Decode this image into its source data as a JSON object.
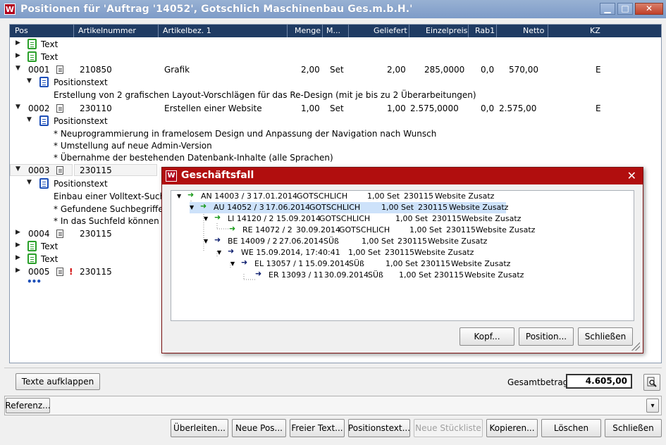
{
  "window": {
    "title": "Positionen für 'Auftrag '14052', Gotschlich Maschinenbau Ges.m.b.H.'",
    "app_icon": "W"
  },
  "grid": {
    "headers": [
      "Pos",
      "Artikelnummer",
      "Artikelbez. 1",
      "Menge",
      "M...",
      "Geliefert",
      "Einzelpreis",
      "Rab1",
      "Netto",
      "KZ"
    ],
    "rows": {
      "r0": {
        "text": "Text"
      },
      "r1": {
        "text": "Text"
      },
      "r2": {
        "pos": "0001",
        "artnr": "210850",
        "bez": "Grafik",
        "menge": "2,00",
        "me": "Set",
        "geliefert": "2,00",
        "ep": "285,0000",
        "rab": "0,0",
        "netto": "570,00",
        "kz": "E"
      },
      "r3": {
        "text": "Positionstext"
      },
      "r4": {
        "text": "Erstellung von 2 grafischen Layout-Vorschlägen für das Re-Design (mit je bis zu 2 Überarbeitungen)"
      },
      "r5": {
        "pos": "0002",
        "artnr": "230110",
        "bez": "Erstellen einer Website",
        "menge": "1,00",
        "me": "Set",
        "geliefert": "1,00",
        "ep": "2.575,0000",
        "rab": "0,0",
        "netto": "2.575,00",
        "kz": "E"
      },
      "r6": {
        "text": "Positionstext"
      },
      "r7": {
        "text": "* Neuprogrammierung in framelosem Design und Anpassung der Navigation nach Wunsch"
      },
      "r8": {
        "text": "* Umstellung auf neue Admin-Version"
      },
      "r9": {
        "text": "* Übernahme der bestehenden Datenbank-Inhalte (alle Sprachen)"
      },
      "r10": {
        "pos": "0003",
        "artnr": "230115"
      },
      "r11": {
        "text": "Positionstext"
      },
      "r12": {
        "text": "Einbau einer Volltext-Such"
      },
      "r13": {
        "text": "* Gefundene Suchbegriffe"
      },
      "r14": {
        "text": "* In das Suchfeld können n"
      },
      "r15": {
        "pos": "0004",
        "artnr": "230115"
      },
      "r16": {
        "text": "Text"
      },
      "r17": {
        "text": "Text"
      },
      "r18": {
        "pos": "0005",
        "artnr": "230115",
        "flag": "!"
      },
      "r19": {
        "text": "•••"
      }
    }
  },
  "footer": {
    "expand_label": "Texte aufklappen",
    "total_label": "Gesamtbetrag:",
    "total_value": "4.605,00",
    "reference_label": "Referenz..."
  },
  "buttons": {
    "ueberleiten": "Überleiten...",
    "neue_pos": "Neue Pos...",
    "freier_text": "Freier Text...",
    "positionstext": "Positionstext...",
    "neue_stueckliste": "Neue Stückliste",
    "kopieren": "Kopieren...",
    "loeschen": "Löschen",
    "schliessen": "Schließen"
  },
  "dialog": {
    "title": "Geschäftsfall",
    "close_glyph": "✕",
    "nodes": [
      {
        "doc": "AN 14003 / 3",
        "date": "17.01.2014",
        "who": "GOTSCHLICH",
        "qty": "1,00 Set",
        "art": "230115",
        "desc": "Website Zusatz"
      },
      {
        "doc": "AU 14052 / 3",
        "date": "17.06.2014",
        "who": "GOTSCHLICH",
        "qty": "1,00 Set",
        "art": "230115",
        "desc": "Website Zusatz"
      },
      {
        "doc": "LI 14120 / 2",
        "date": "15.09.2014",
        "who": "GOTSCHLICH",
        "qty": "1,00 Set",
        "art": "230115",
        "desc": "Website Zusatz"
      },
      {
        "doc": "RE 14072 / 2",
        "date": "30.09.2014",
        "who": "GOTSCHLICH",
        "qty": "1,00 Set",
        "art": "230115",
        "desc": "Website Zusatz"
      },
      {
        "doc": "BE 14009 / 2",
        "date": "27.06.2014",
        "who": "SÜß",
        "qty": "1,00 Set",
        "art": "230115",
        "desc": "Website Zusatz"
      },
      {
        "doc": "WE 15.09.2014, 17:40:41",
        "date": "",
        "who": "",
        "qty": "1,00 Set",
        "art": "230115",
        "desc": "Website Zusatz"
      },
      {
        "doc": "EL 13057 / 1",
        "date": "15.09.2014",
        "who": "SÜß",
        "qty": "1,00 Set",
        "art": "230115",
        "desc": "Website Zusatz"
      },
      {
        "doc": "ER 13093 / 11",
        "date": "30.09.2014",
        "who": "SÜß",
        "qty": "1,00 Set",
        "art": "230115",
        "desc": "Website Zusatz"
      }
    ],
    "btn_kopf": "Kopf...",
    "btn_position": "Position...",
    "btn_close": "Schließen"
  },
  "colors": {
    "header_bg": "#1f3b63",
    "dialog_title": "#b10e0e",
    "selection": "#cde2fa",
    "arrow_green": "#1a9a1a",
    "arrow_navy": "#0d1e6e"
  }
}
